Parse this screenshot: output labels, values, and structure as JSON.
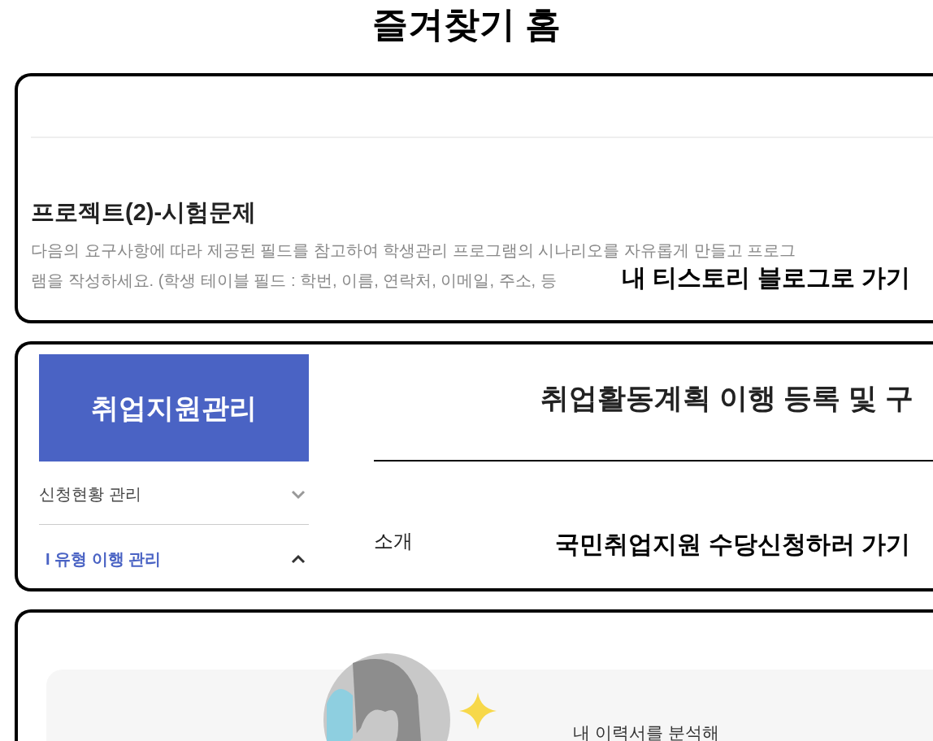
{
  "title": "즐겨찾기 홈",
  "favorites": [
    {
      "kind": "post",
      "heading": "프로젝트(2)-시험문제",
      "lines": [
        "다음의 요구사항에 따라 제공된 필드를 참고하여 학생관리 프로그램의 시나리오를 자유롭게 만들고 프로그",
        "램을 작성하세요. (학생 테이블 필드 : 학번, 이름, 연락처, 이메일, 주소, 등"
      ],
      "link_label": "내 티스토리 블로그로 가기"
    },
    {
      "kind": "portal",
      "brand": "취업지원관리",
      "menu": [
        {
          "label": "신청현황 관리",
          "expanded": false
        },
        {
          "label": "I 유형 이행 관리",
          "expanded": true
        }
      ],
      "page_title": "취업활동계획 이행 등록 및 구",
      "section": "소개",
      "link_label": "국민취업지원 수당신청하러 가기"
    },
    {
      "kind": "promo",
      "caption": "내 이력서를 분석해"
    }
  ]
}
